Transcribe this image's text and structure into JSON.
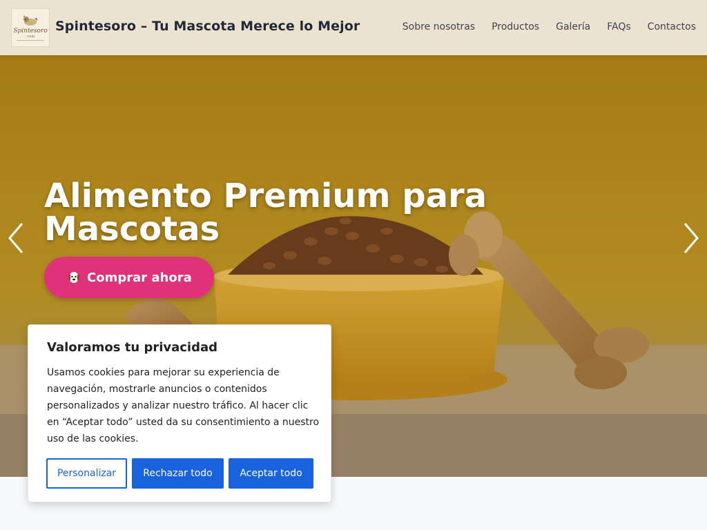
{
  "header": {
    "logo": {
      "word": "Spintesoro",
      "sub": ".com"
    },
    "title": "Spintesoro – Tu Mascota Merece lo Mejor",
    "nav": [
      "Sobre nosotras",
      "Productos",
      "Galería",
      "FAQs",
      "Contactos"
    ]
  },
  "hero": {
    "heading": "Alimento Premium para Mascotas",
    "cta_label": "Comprar ahora",
    "cta_icon": "dog-icon",
    "prev_icon": "chevron-left-icon",
    "next_icon": "chevron-right-icon"
  },
  "cookie": {
    "title": "Valoramos tu privacidad",
    "text": "Usamos cookies para mejorar su experiencia de navegación, mostrarle anuncios o contenidos personalizados y analizar nuestro tráfico. Al hacer clic en “Aceptar todo” usted da su consentimiento a nuestro uso de las cookies.",
    "buttons": {
      "customize": "Personalizar",
      "reject": "Rechazar todo",
      "accept": "Aceptar todo"
    }
  },
  "colors": {
    "header_bg": "#ece2d0",
    "cta_bg": "#e0317b",
    "cookie_button": "#1863dc"
  }
}
